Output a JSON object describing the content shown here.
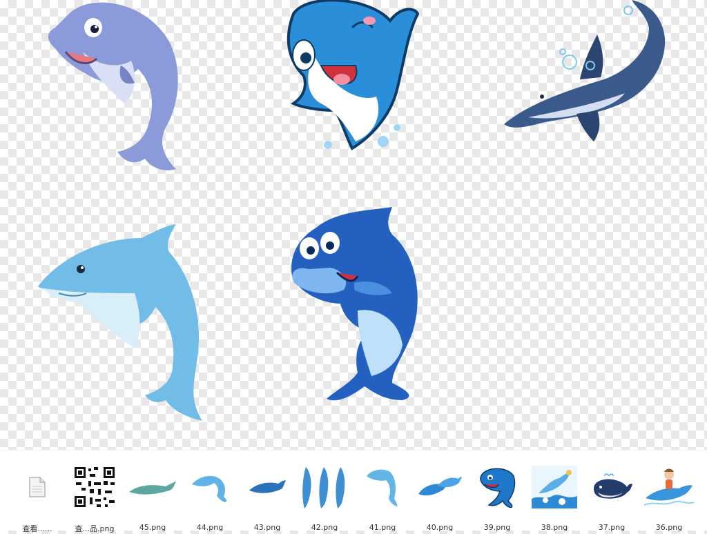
{
  "colors": {
    "checker_light": "#ffffff",
    "checker_dark": "#e8e8e8",
    "dolphin_lavender": "#8b9ad8",
    "dolphin_cartoon_blue": "#2a8fd8",
    "dolphin_navy": "#3a5a8c",
    "dolphin_sky": "#72bde8",
    "dolphin_royal": "#2460c0"
  },
  "canvas": {
    "icons": [
      "dolphin-lavender-icon",
      "dolphin-winking-icon",
      "dolphin-navy-bubbles-icon",
      "dolphin-sky-jumping-icon",
      "dolphin-smiling-blue-icon"
    ]
  },
  "thumbnails": [
    {
      "label": "查看......",
      "icon": "document-icon"
    },
    {
      "label": "查...品.png",
      "icon": "qr-code-icon"
    },
    {
      "label": "45.png",
      "icon": "dolphin-thumb-icon"
    },
    {
      "label": "44.png",
      "icon": "dolphin-thumb-icon"
    },
    {
      "label": "43.png",
      "icon": "dolphin-thumb-icon"
    },
    {
      "label": "42.png",
      "icon": "dolphin-group-thumb-icon"
    },
    {
      "label": "41.png",
      "icon": "dolphin-thumb-icon"
    },
    {
      "label": "40.png",
      "icon": "dolphin-pair-thumb-icon"
    },
    {
      "label": "39.png",
      "icon": "dolphin-cartoon-thumb-icon"
    },
    {
      "label": "38.png",
      "icon": "dolphin-splash-thumb-icon"
    },
    {
      "label": "37.png",
      "icon": "whale-thumb-icon"
    },
    {
      "label": "36.png",
      "icon": "dolphin-rider-thumb-icon"
    }
  ]
}
